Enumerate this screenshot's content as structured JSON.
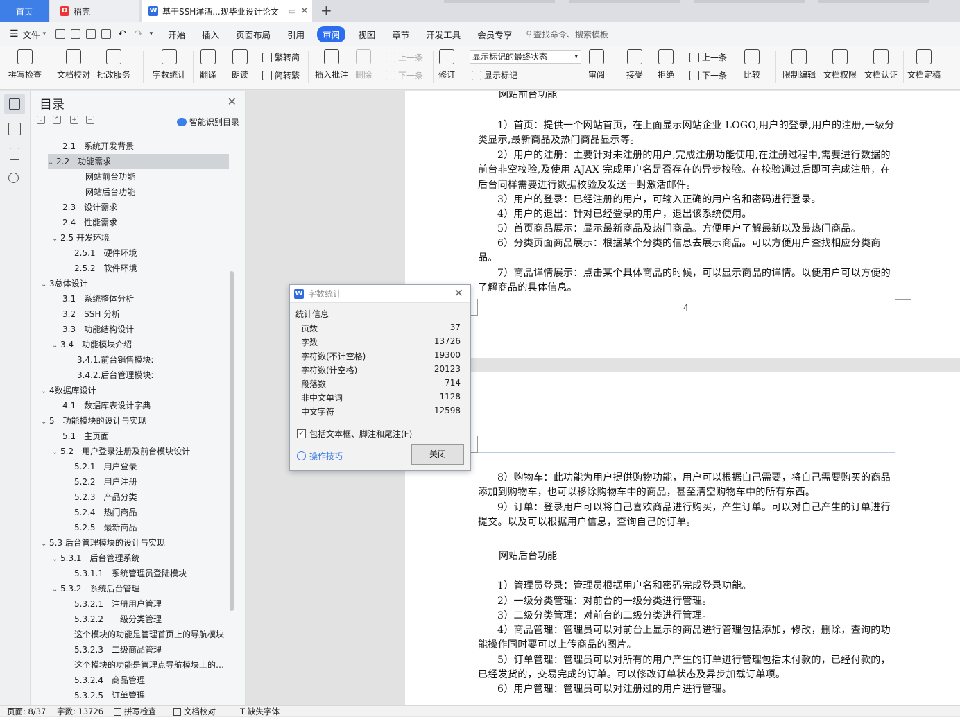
{
  "tabs": {
    "home": "首页",
    "daoke": "稻壳",
    "doc": "基于SSH洋酒...现毕业设计论文"
  },
  "menubar": {
    "file": "文件",
    "items": [
      "开始",
      "插入",
      "页面布局",
      "引用",
      "审阅",
      "视图",
      "章节",
      "开发工具",
      "会员专享"
    ],
    "active": "审阅",
    "search": "查找命令、搜索模板"
  },
  "toolbar": {
    "spell": "拼写检查",
    "proofread": "文档校对",
    "annotate_service": "批改服务",
    "word_count": "字数统计",
    "translate": "翻译",
    "read_aloud": "朗读",
    "trad": "繁转简",
    "simp": "简转繁",
    "insert_comment": "插入批注",
    "delete": "删除",
    "prev1": "上一条",
    "next1": "下一条",
    "revise": "修订",
    "markup_select": "显示标记的最终状态",
    "show_markup": "显示标记",
    "review": "审阅",
    "accept": "接受",
    "reject": "拒绝",
    "prev2": "上一条",
    "next2": "下一条",
    "compare": "比较",
    "restrict": "限制编辑",
    "permission": "文档权限",
    "cert": "文档认证",
    "finalize": "文档定稿"
  },
  "toc": {
    "title": "目录",
    "smart": "智能识别目录",
    "items": [
      "2.1　系统开发背景",
      "2.2　功能需求",
      "网站前台功能",
      "网站后台功能",
      "2.3　设计需求",
      "2.4　性能需求",
      "2.5 开发环境",
      "2.5.1　硬件环境",
      "2.5.2　软件环境",
      "3总体设计",
      "3.1　系统整体分析",
      "3.2　SSH 分析",
      "3.3　功能结构设计",
      "3.4　功能模块介绍",
      "3.4.1.前台销售模块:",
      "3.4.2.后台管理模块:",
      "4数据库设计",
      "4.1　数据库表设计字典",
      "5　功能模块的设计与实现",
      "5.1　主页面",
      "5.2　用户登录注册及前台模块设计",
      "5.2.1　用户登录",
      "5.2.2　用户注册",
      "5.2.3　产品分类",
      "5.2.4　热门商品",
      "5.2.5　最新商品",
      "5.3 后台管理模块的设计与实现",
      "5.3.1　后台管理系统",
      "5.3.1.1　系统管理员登陆模块",
      "5.3.2　系统后台管理",
      "5.3.2.1　注册用户管理",
      "5.3.2.2　一级分类管理",
      "这个模块的功能是管理首页上的导航模块",
      "5.3.2.3　二级商品管理",
      "这个模块的功能是管理点导航模块上的二级",
      "5.3.2.4　商品管理",
      "5.3.2.5　订单管理"
    ]
  },
  "page1": {
    "heading": "网站前台功能",
    "paras": [
      "1）首页：提供一个网站首页，在上面显示网站企业 LOGO,用户的登录,用户的注册,一级分类显示,最新商品及热门商品显示等。",
      "2）用户的注册：主要针对未注册的用户,完成注册功能使用,在注册过程中,需要进行数据的前台非空校验,及使用 AJAX 完成用户名是否存在的异步校验。在校验通过后即可完成注册，在后台同样需要进行数据校验及发送一封激活邮件。",
      "3）用户的登录：已经注册的用户，可输入正确的用户名和密码进行登录。",
      "4）用户的退出：针对已经登录的用户，退出该系统使用。",
      "5）首页商品展示：显示最新商品及热门商品。方便用户了解最新以及最热门商品。",
      "6）分类页面商品展示：根据某个分类的信息去展示商品。可以方便用户查找相应分类商品。",
      "7）商品详情展示：点击某个具体商品的时候，可以显示商品的详情。以便用户可以方便的了解商品的具体信息。"
    ],
    "page_number": "4"
  },
  "page2": {
    "paras_a": [
      "8）购物车：此功能为用户提供购物功能，用户可以根据自己需要，将自己需要购买的商品添加到购物车，也可以移除购物车中的商品，甚至清空购物车中的所有东西。",
      "9）订单：登录用户可以将自己喜欢商品进行购买，产生订单。可以对自己产生的订单进行提交。以及可以根据用户信息，查询自己的订单。"
    ],
    "heading": "网站后台功能",
    "paras_b": [
      "1）管理员登录：管理员根据用户名和密码完成登录功能。",
      "2）一级分类管理：对前台的一级分类进行管理。",
      "3）二级分类管理：对前台的二级分类进行管理。",
      "4）商品管理：管理员可以对前台上显示的商品进行管理包括添加，修改，删除，查询的功能操作同时要可以上传商品的图片。",
      "5）订单管理：管理员可以对所有的用户产生的订单进行管理包括未付款的，已经付款的，已经发货的，交易完成的订单。可以修改订单状态及异步加载订单项。",
      "6）用户管理：管理员可以对注册过的用户进行管理。"
    ]
  },
  "word_count_dialog": {
    "title": "字数统计",
    "section": "统计信息",
    "rows": [
      {
        "label": "页数",
        "value": "37"
      },
      {
        "label": "字数",
        "value": "13726"
      },
      {
        "label": "字符数(不计空格)",
        "value": "19300"
      },
      {
        "label": "字符数(计空格)",
        "value": "20123"
      },
      {
        "label": "段落数",
        "value": "714"
      },
      {
        "label": "非中文单词",
        "value": "1128"
      },
      {
        "label": "中文字符",
        "value": "12598"
      }
    ],
    "checkbox_label": "包括文本框、脚注和尾注(F)",
    "checkbox_checked": true,
    "tips": "操作技巧",
    "close": "关闭"
  },
  "status": {
    "page": "页面: 8/37",
    "words": "字数: 13726",
    "spell": "拼写检查",
    "proof": "文档校对",
    "font": "缺失字体"
  }
}
